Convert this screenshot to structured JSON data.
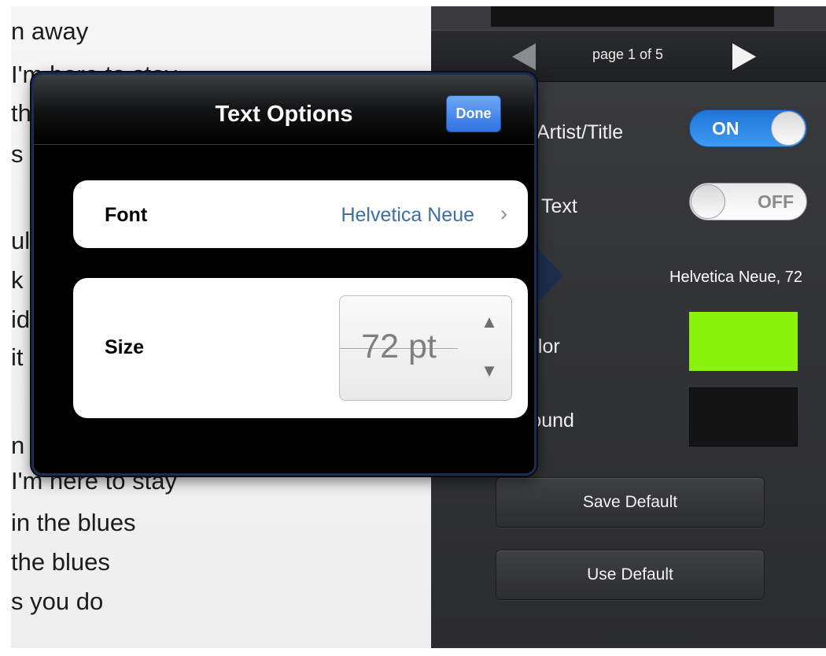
{
  "lyrics": {
    "lines": [
      "n away",
      "I'm here to stay",
      "th",
      "s y",
      "ul",
      "k",
      "id",
      "it",
      "n a",
      "I'm here to stay",
      "in the blues",
      "the blues",
      "s you do"
    ]
  },
  "pager": {
    "label": "page 1 of 5",
    "prev_icon": "left-triangle-icon",
    "next_icon": "right-triangle-icon"
  },
  "settings": {
    "artist_title": {
      "label": "Artist/Title",
      "toggle_text": "ON",
      "state": true
    },
    "text": {
      "label": "Text",
      "toggle_text": "OFF",
      "state": false
    },
    "font_value": "Helvetica Neue, 72",
    "color": {
      "label": "Color",
      "label_visible": "olor",
      "swatch": "#8bf20e"
    },
    "background": {
      "label": "Background",
      "label_visible": "round",
      "swatch": "#141414"
    },
    "save_default": "Save Default",
    "use_default": "Use Default"
  },
  "popover": {
    "title": "Text Options",
    "done_label": "Done",
    "font_label": "Font",
    "font_value": "Helvetica Neue",
    "chevron": "›",
    "size_label": "Size",
    "size_value": "72 pt",
    "stepper_up": "▲",
    "stepper_down": "▼"
  }
}
